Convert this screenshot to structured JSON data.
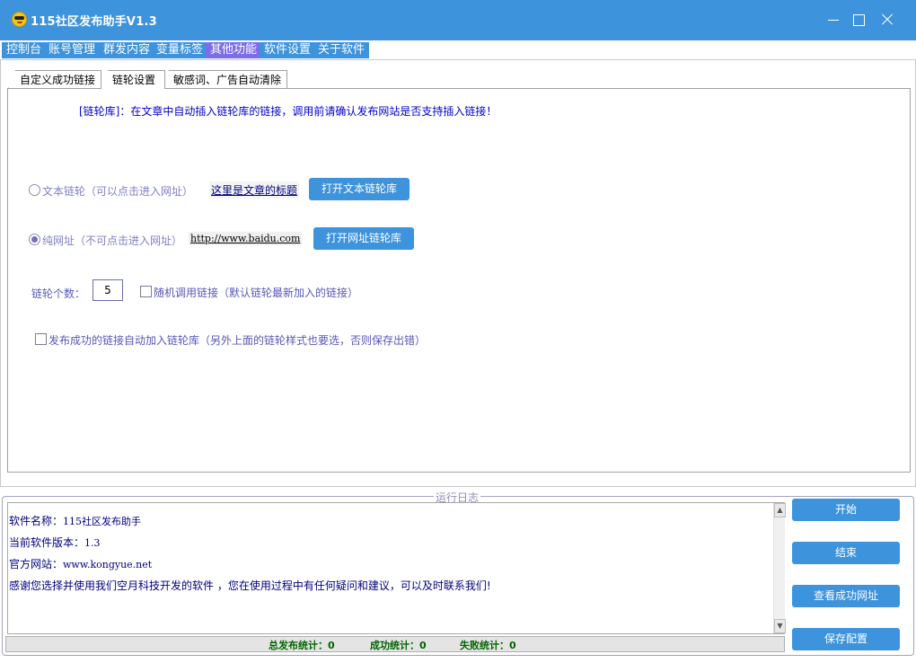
{
  "window": {
    "title": "115社区发布助手V1.3",
    "icon": "sunglasses-smiley-icon"
  },
  "menu": {
    "items": [
      "控制台",
      "账号管理",
      "群发内容",
      "变量标签",
      "其他功能",
      "软件设置",
      "关于软件"
    ],
    "active": "其他功能"
  },
  "tabs": {
    "items": [
      "自定义成功链接",
      "链轮设置",
      "敏感词、广告自动清除"
    ],
    "active": "链轮设置"
  },
  "link_settings": {
    "info": "[链轮库]：在文章中自动插入链轮库的链接，调用前请确认发布网站是否支持插入链接！",
    "text_link_label": "文本链轮（可以点击进入网址）",
    "text_link_sample": "这里是文章的标题",
    "open_text_button": "打开文本链轮库",
    "url_label": "纯网址（不可点击进入网址）",
    "url_sample": "http://www.baidu.com",
    "open_url_button": "打开网址链轮库",
    "selected_mode": "纯网址",
    "count_label": "链轮个数：",
    "count_value": "5",
    "random_label": "随机调用链接（默认链轮最新加入的链接）",
    "auto_add_label": "发布成功的链接自动加入链轮库（另外上面的链轮样式也要选，否则保存出错）"
  },
  "log": {
    "legend": "运行日志",
    "lines": [
      {
        "label": "软件名称：",
        "value": "115社区发布助手"
      },
      {
        "label": "当前软件版本：",
        "value": "1.3"
      },
      {
        "label": "官方网站：",
        "value": "www.kongyue.net"
      },
      {
        "label": "感谢您选择并使用我们空月科技开发的软件 ，您在使用过程中有任何疑问和建议，可以及时联系我们!",
        "value": ""
      }
    ]
  },
  "stats": {
    "total": "总发布统计：0",
    "success": "成功统计：0",
    "fail": "失败统计：0"
  },
  "actions": {
    "start": "开始",
    "stop": "结束",
    "view_success": "查看成功网址",
    "save": "保存配置"
  },
  "colors": {
    "titlebar": "#3d93dc",
    "menu_active": "#7b6ee8",
    "button": "#3d93dc",
    "stats_text": "#006400"
  }
}
